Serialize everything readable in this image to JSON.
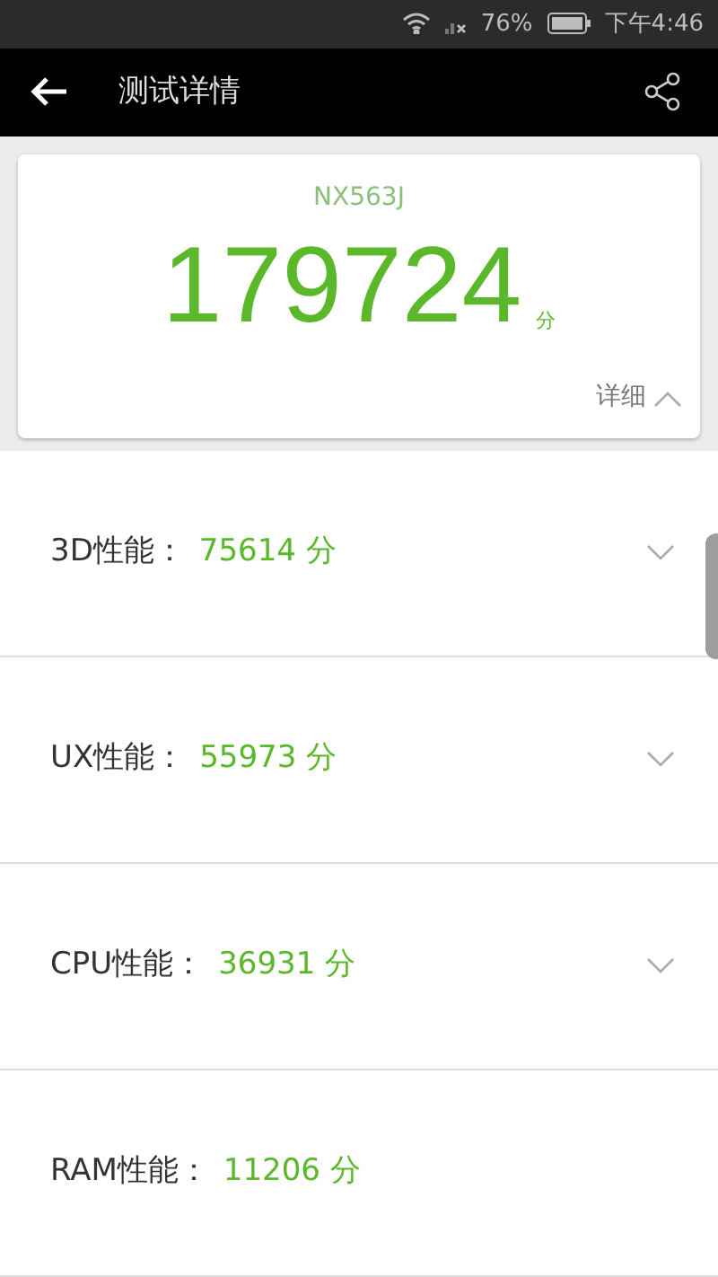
{
  "status_bar": {
    "battery": "76%",
    "time": "下午4:46"
  },
  "app_bar": {
    "title": "测试详情"
  },
  "summary": {
    "device": "NX563J",
    "score": "179724",
    "unit": "分",
    "details": {
      "label": "详细",
      "expanded": true
    }
  },
  "scores": [
    {
      "label": "3D性能：",
      "value": "75614 分",
      "kind": "expandable"
    },
    {
      "label": "UX性能：",
      "value": "55973 分",
      "kind": "expandable"
    },
    {
      "label": "CPU性能：",
      "value": "36931 分",
      "kind": "expandable"
    },
    {
      "label": "RAM性能：",
      "value": "11206 分",
      "kind": "plain"
    }
  ]
}
